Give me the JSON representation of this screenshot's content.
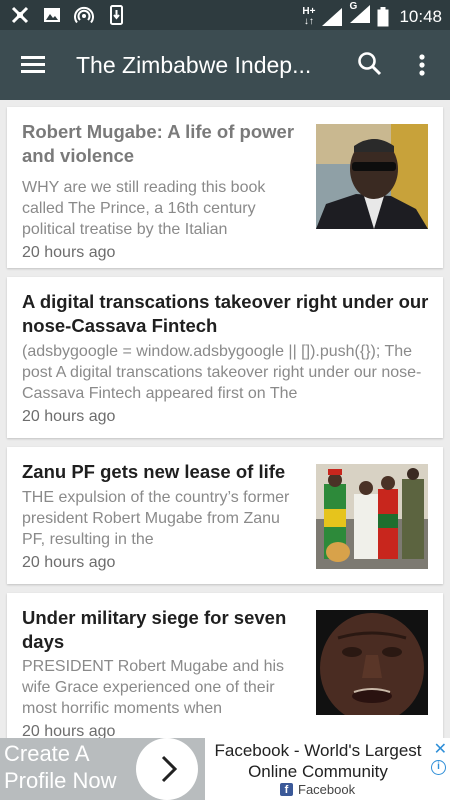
{
  "status_bar": {
    "time": "10:48",
    "network_type": "H+",
    "sim2_label": "G",
    "icons": [
      "app-notification-icon",
      "image-icon",
      "hotspot-icon",
      "phone-download-icon",
      "signal-icon",
      "signal-icon",
      "battery-icon"
    ]
  },
  "app_bar": {
    "title": "The Zimbabwe Indep...",
    "icons": [
      "menu-icon",
      "search-icon",
      "more-vert-icon"
    ]
  },
  "articles": [
    {
      "title": "Robert Mugabe: A life of power and violence",
      "excerpt": "WHY are we still reading this book called The Prince, a 16th century political treatise by the Italian",
      "time": "20 hours ago",
      "has_image": true
    },
    {
      "title": "A digital transcations takeover right under our nose-Cassava Fintech",
      "excerpt": "(adsbygoogle = window.adsbygoogle || []).push({}); The post A digital transcations takeover right under our nose-Cassava Fintech appeared first on The",
      "time": "20 hours ago",
      "has_image": false
    },
    {
      "title": "Zanu PF gets new lease of life",
      "excerpt": "THE expulsion of the country’s former president Robert Mugabe from Zanu PF, resulting in the",
      "time": "20 hours ago",
      "has_image": true
    },
    {
      "title": "Under military siege for seven days",
      "excerpt": "PRESIDENT Robert Mugabe and his wife Grace experienced one of their most horrific moments when",
      "time": "20 hours ago",
      "has_image": true
    }
  ],
  "ad": {
    "cta": "Create A Profile Now",
    "headline": "Facebook - World's Largest Online Community",
    "brand": "Facebook",
    "close_symbol": "✕",
    "info_symbol": "i"
  },
  "colors": {
    "status_bar": "#2e3b3f",
    "app_bar": "#3c4c51",
    "background": "#ececec",
    "ad_left": "#b8bcbe",
    "ad_accent": "#2f8fd8"
  }
}
